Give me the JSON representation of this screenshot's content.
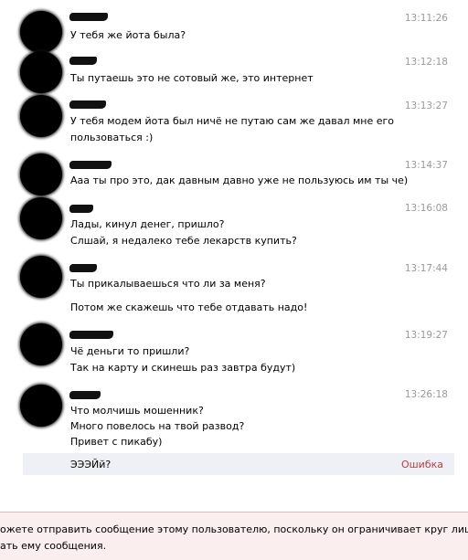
{
  "messages": [
    {
      "time": "13:11:26",
      "lines": [
        "У тебя же йота была?"
      ]
    },
    {
      "time": "13:12:18",
      "lines": [
        "Ты путаешь это не сотовый же, это интернет"
      ]
    },
    {
      "time": "13:13:27",
      "lines": [
        "У тебя модем йота был ничё не путаю сам же давал мне его",
        "пользоваться :)"
      ]
    },
    {
      "time": "13:14:37",
      "lines": [
        "Ааа ты про это, дак давным давно уже не пользуюсь им ты че)"
      ]
    },
    {
      "time": "13:16:08",
      "lines": [
        "Лады, кинул денег, пришло?",
        "Слшай, я недалеко тебе лекарств купить?"
      ]
    },
    {
      "time": "13:17:44",
      "lines": [
        "Ты прикалываешься что ли за меня?",
        "Потом же скажешь что тебе отдавать надо!"
      ]
    },
    {
      "time": "13:19:27",
      "lines": [
        "Чё деньги то пришли?",
        "Так на карту и скинешь раз завтра будут)"
      ]
    },
    {
      "time": "13:26:18",
      "lines": [
        "Что молчишь мошенник?",
        "Много повелось на твой развод?",
        "Привет с пикабу)"
      ]
    }
  ],
  "failed_message": {
    "text": "ЭЭЭЙй?",
    "status": "Ошибка"
  },
  "notice": {
    "line1": "ожете отправить сообщение этому пользователю, поскольку он ограничивает круг лиц, которые м",
    "line2": "ать ему сообщения."
  }
}
